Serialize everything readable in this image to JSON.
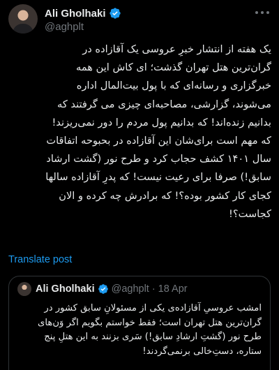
{
  "author": {
    "name": "Ali Gholhaki",
    "handle": "@aghplt",
    "verified_color": "#1d9bf0"
  },
  "tweet": {
    "text": "یک هفته از انتشار خبرِ عروسی یک آقازاده در\nگران‌ترین هتل تهران گذشت؛ ای کاش این همه\nخبرگزاری و رسانه‌ای که با پول بیت‌المال اداره\nمی‌شوند، گزارشی، مصاحبه‌ای چیزی می گرفتند که\nبدانیم زنده‌اند! که بدانیم پول مردم را دور نمی‌ریزند!\nکه مهم است برای‌شان این آقازاده در بحبوحه اتفاقات\nسال ۱۴۰۱ کشف حجاب کرد و طرح نور (گشت ارشاد\nسابق!) صرفا برای رعیت نیست! که پدرِ آقازاده سالها\nکجای کار کشور بوده؟! که برادرش چه کرده و الان\nکجاست؟!",
    "translate_label": "Translate post"
  },
  "quote": {
    "name": "Ali Gholhaki",
    "handle": "@aghplt",
    "separator": "·",
    "date": "18 Apr",
    "text": "امشب عروسیِ آقازاده‌ی یکی از مسئولانِ سابق کشور در\nگران‌ترین هتل تهران است؛ فقط خواستم بگویم اگر وَن‌های\nطرح نور (گشتِ ارشادِ سابق!) سَری بزنند به این هتلِ پنج\nستاره، دستِ‌خالی برنمی‌گردند!"
  },
  "colors": {
    "background": "#000000",
    "text": "#e7e9ea",
    "secondary": "#71767b",
    "link": "#1d9bf0",
    "border": "#2f3336"
  }
}
